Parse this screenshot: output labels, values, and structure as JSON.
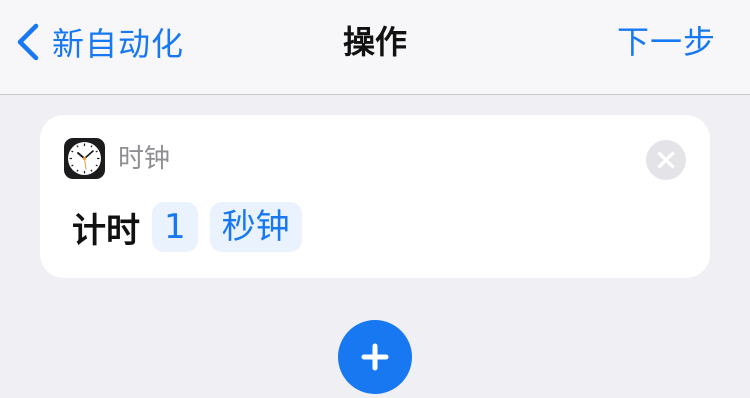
{
  "nav": {
    "back_label": "新自动化",
    "title": "操作",
    "next_label": "下一步"
  },
  "action_card": {
    "app_name": "时钟",
    "app_icon": "clock-icon",
    "action_label": "计时",
    "duration_value": "1",
    "duration_unit": "秒钟"
  },
  "colors": {
    "accent": "#1778f2",
    "background": "#efeff4",
    "card": "#ffffff"
  }
}
